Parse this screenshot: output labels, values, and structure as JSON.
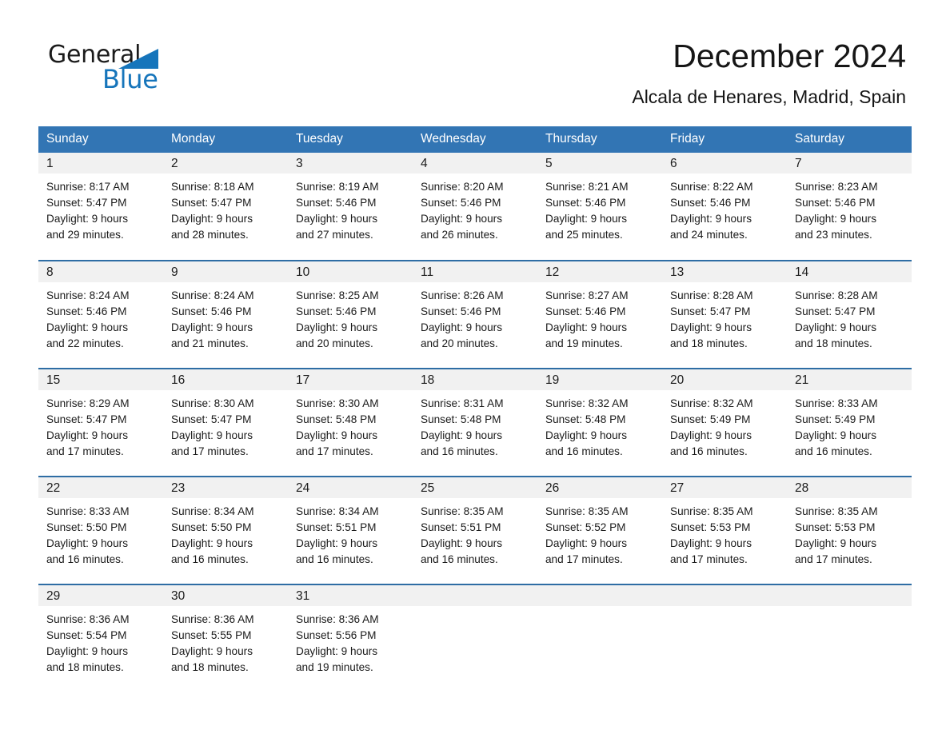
{
  "brand": {
    "name_part1": "General",
    "name_part2": "Blue",
    "accent_color": "#1675bb",
    "triangle_icon": "brand-triangle-icon"
  },
  "header": {
    "title": "December 2024",
    "location": "Alcala de Henares, Madrid, Spain"
  },
  "calendar": {
    "header_bg": "#3275b4",
    "row_separator_color": "#2e6da4",
    "daynum_band_bg": "#f1f1f1",
    "weekdays": [
      "Sunday",
      "Monday",
      "Tuesday",
      "Wednesday",
      "Thursday",
      "Friday",
      "Saturday"
    ],
    "weeks": [
      [
        {
          "day": "1",
          "info": "Sunrise: 8:17 AM\nSunset: 5:47 PM\nDaylight: 9 hours\nand 29 minutes."
        },
        {
          "day": "2",
          "info": "Sunrise: 8:18 AM\nSunset: 5:47 PM\nDaylight: 9 hours\nand 28 minutes."
        },
        {
          "day": "3",
          "info": "Sunrise: 8:19 AM\nSunset: 5:46 PM\nDaylight: 9 hours\nand 27 minutes."
        },
        {
          "day": "4",
          "info": "Sunrise: 8:20 AM\nSunset: 5:46 PM\nDaylight: 9 hours\nand 26 minutes."
        },
        {
          "day": "5",
          "info": "Sunrise: 8:21 AM\nSunset: 5:46 PM\nDaylight: 9 hours\nand 25 minutes."
        },
        {
          "day": "6",
          "info": "Sunrise: 8:22 AM\nSunset: 5:46 PM\nDaylight: 9 hours\nand 24 minutes."
        },
        {
          "day": "7",
          "info": "Sunrise: 8:23 AM\nSunset: 5:46 PM\nDaylight: 9 hours\nand 23 minutes."
        }
      ],
      [
        {
          "day": "8",
          "info": "Sunrise: 8:24 AM\nSunset: 5:46 PM\nDaylight: 9 hours\nand 22 minutes."
        },
        {
          "day": "9",
          "info": "Sunrise: 8:24 AM\nSunset: 5:46 PM\nDaylight: 9 hours\nand 21 minutes."
        },
        {
          "day": "10",
          "info": "Sunrise: 8:25 AM\nSunset: 5:46 PM\nDaylight: 9 hours\nand 20 minutes."
        },
        {
          "day": "11",
          "info": "Sunrise: 8:26 AM\nSunset: 5:46 PM\nDaylight: 9 hours\nand 20 minutes."
        },
        {
          "day": "12",
          "info": "Sunrise: 8:27 AM\nSunset: 5:46 PM\nDaylight: 9 hours\nand 19 minutes."
        },
        {
          "day": "13",
          "info": "Sunrise: 8:28 AM\nSunset: 5:47 PM\nDaylight: 9 hours\nand 18 minutes."
        },
        {
          "day": "14",
          "info": "Sunrise: 8:28 AM\nSunset: 5:47 PM\nDaylight: 9 hours\nand 18 minutes."
        }
      ],
      [
        {
          "day": "15",
          "info": "Sunrise: 8:29 AM\nSunset: 5:47 PM\nDaylight: 9 hours\nand 17 minutes."
        },
        {
          "day": "16",
          "info": "Sunrise: 8:30 AM\nSunset: 5:47 PM\nDaylight: 9 hours\nand 17 minutes."
        },
        {
          "day": "17",
          "info": "Sunrise: 8:30 AM\nSunset: 5:48 PM\nDaylight: 9 hours\nand 17 minutes."
        },
        {
          "day": "18",
          "info": "Sunrise: 8:31 AM\nSunset: 5:48 PM\nDaylight: 9 hours\nand 16 minutes."
        },
        {
          "day": "19",
          "info": "Sunrise: 8:32 AM\nSunset: 5:48 PM\nDaylight: 9 hours\nand 16 minutes."
        },
        {
          "day": "20",
          "info": "Sunrise: 8:32 AM\nSunset: 5:49 PM\nDaylight: 9 hours\nand 16 minutes."
        },
        {
          "day": "21",
          "info": "Sunrise: 8:33 AM\nSunset: 5:49 PM\nDaylight: 9 hours\nand 16 minutes."
        }
      ],
      [
        {
          "day": "22",
          "info": "Sunrise: 8:33 AM\nSunset: 5:50 PM\nDaylight: 9 hours\nand 16 minutes."
        },
        {
          "day": "23",
          "info": "Sunrise: 8:34 AM\nSunset: 5:50 PM\nDaylight: 9 hours\nand 16 minutes."
        },
        {
          "day": "24",
          "info": "Sunrise: 8:34 AM\nSunset: 5:51 PM\nDaylight: 9 hours\nand 16 minutes."
        },
        {
          "day": "25",
          "info": "Sunrise: 8:35 AM\nSunset: 5:51 PM\nDaylight: 9 hours\nand 16 minutes."
        },
        {
          "day": "26",
          "info": "Sunrise: 8:35 AM\nSunset: 5:52 PM\nDaylight: 9 hours\nand 17 minutes."
        },
        {
          "day": "27",
          "info": "Sunrise: 8:35 AM\nSunset: 5:53 PM\nDaylight: 9 hours\nand 17 minutes."
        },
        {
          "day": "28",
          "info": "Sunrise: 8:35 AM\nSunset: 5:53 PM\nDaylight: 9 hours\nand 17 minutes."
        }
      ],
      [
        {
          "day": "29",
          "info": "Sunrise: 8:36 AM\nSunset: 5:54 PM\nDaylight: 9 hours\nand 18 minutes."
        },
        {
          "day": "30",
          "info": "Sunrise: 8:36 AM\nSunset: 5:55 PM\nDaylight: 9 hours\nand 18 minutes."
        },
        {
          "day": "31",
          "info": "Sunrise: 8:36 AM\nSunset: 5:56 PM\nDaylight: 9 hours\nand 19 minutes."
        },
        {
          "day": "",
          "info": ""
        },
        {
          "day": "",
          "info": ""
        },
        {
          "day": "",
          "info": ""
        },
        {
          "day": "",
          "info": ""
        }
      ]
    ]
  }
}
